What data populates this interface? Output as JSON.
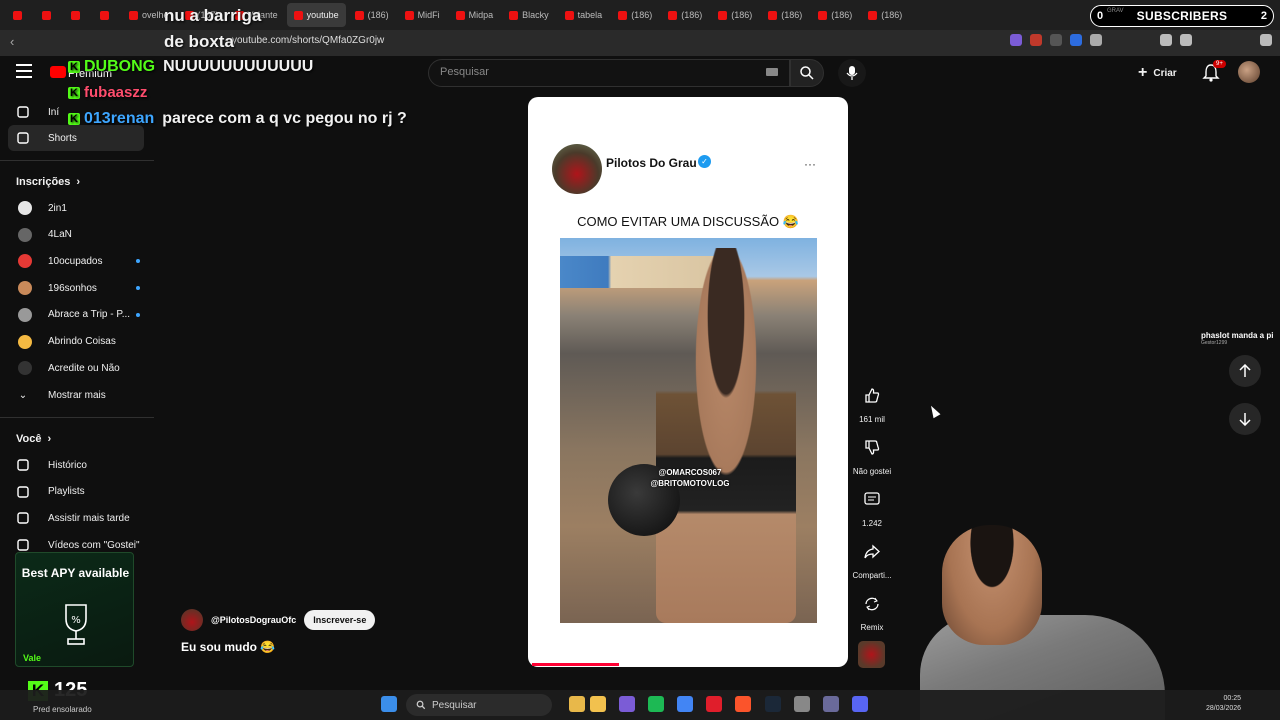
{
  "browser": {
    "tabs": [
      "",
      "",
      "",
      "",
      "ovelhe",
      "(187)",
      "Volante",
      "youtube",
      "(186)",
      "MidFi",
      "Midpa",
      "Blacky",
      "tabela",
      "(186)",
      "(186)",
      "(186)",
      "(186)",
      "(186)",
      "(186)"
    ],
    "active_tab_index": 7,
    "url": "youtube.com/shorts/QMfa0ZGr0jw"
  },
  "stream_overlay": {
    "subscribers_count_left": "0",
    "subscribers_label": "SUBSCRIBERS",
    "subscribers_count_right": "2",
    "recording_label": "GRAV",
    "chat": [
      {
        "user": "",
        "message": "nu a barriga",
        "user_color": "#ff4d6d"
      },
      {
        "user": "",
        "message": "de boxta",
        "user_color": "#ff4d6d"
      },
      {
        "user": "DUBONG",
        "message": "NUUUUUUUUUUUU",
        "user_color": "#53fc18"
      },
      {
        "user": "fubaaszz",
        "message": "",
        "user_color": "#ff4d6d"
      },
      {
        "user": "013renan",
        "message": "parece com a q vc pegou no rj ?",
        "user_color": "#3ea6ff"
      }
    ],
    "kick_count": "125",
    "ad_title": "Best APY available",
    "ad_cta": "Vale",
    "side_notice": "phaslot manda a pi",
    "side_notice_sub": "Gestor1299"
  },
  "youtube": {
    "logo_text": "Premium",
    "search_placeholder": "Pesquisar",
    "create_label": "Criar",
    "notif_badge": "9+",
    "sidebar": {
      "top_items": [
        {
          "label": "Iní",
          "icon": "home-icon"
        },
        {
          "label": "Shorts",
          "icon": "shorts-icon",
          "active": true
        }
      ],
      "subs_heading": "Inscrições",
      "channels": [
        {
          "name": "2in1",
          "color": "#e6e6e6",
          "dot": false
        },
        {
          "name": "4LaN",
          "color": "#666",
          "dot": false
        },
        {
          "name": "10ocupados",
          "color": "#e53935",
          "dot": true
        },
        {
          "name": "196sonhos",
          "color": "#c98a5a",
          "dot": true
        },
        {
          "name": "Abrace a Trip - P...",
          "color": "#999",
          "dot": true
        },
        {
          "name": "Abrindo Coisas",
          "color": "#f4b942",
          "dot": false
        },
        {
          "name": "Acredite ou Não",
          "color": "#333",
          "dot": false
        }
      ],
      "show_more": "Mostrar mais",
      "you_heading": "Você",
      "you_items": [
        {
          "label": "Histórico",
          "icon": "history-icon"
        },
        {
          "label": "Playlists",
          "icon": "playlist-icon"
        },
        {
          "label": "Assistir mais tarde",
          "icon": "clock-icon"
        },
        {
          "label": "Vídeos com \"Gostei\"",
          "icon": "like-icon"
        }
      ]
    },
    "short": {
      "author": "Pilotos Do Grau",
      "caption": "COMO EVITAR UMA DISCUSSÃO 😂",
      "watermark_1": "@OMARCOS067",
      "watermark_2": "@BRITOMOTOVLOG",
      "channel_handle": "@PilotosDograuOfc",
      "subscribe_label": "Inscrever-se",
      "title": "Eu sou mudo 😂",
      "progress": 0.28,
      "actions": [
        {
          "icon": "thumbs-up-icon",
          "label": "161 mil"
        },
        {
          "icon": "thumbs-down-icon",
          "label": "Não gostei"
        },
        {
          "icon": "comment-icon",
          "label": "1.242"
        },
        {
          "icon": "share-icon",
          "label": "Comparti..."
        },
        {
          "icon": "remix-icon",
          "label": "Remix"
        }
      ]
    }
  },
  "taskbar": {
    "search_placeholder": "Pesquisar",
    "weather": "Pred ensolarado",
    "time": "00:25",
    "date": "28/03/2026"
  }
}
